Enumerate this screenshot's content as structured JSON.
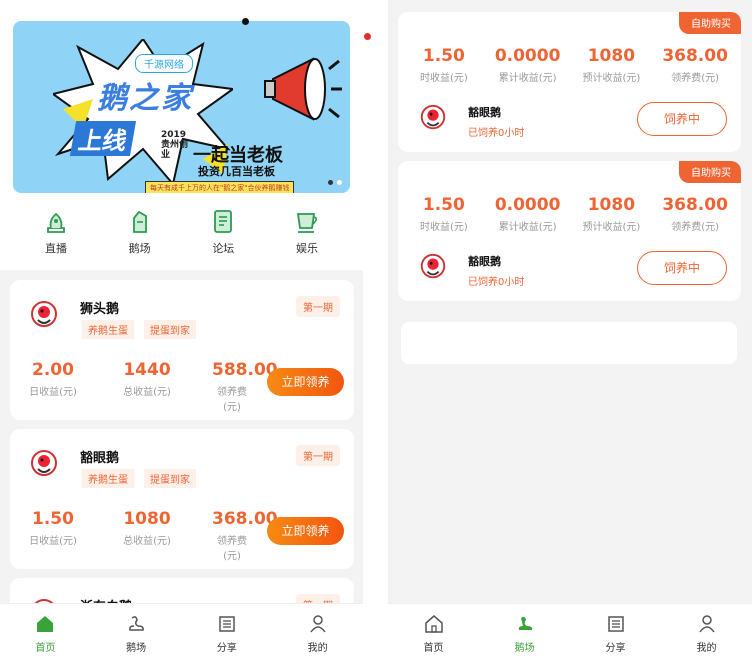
{
  "banner": {
    "tag": "千源网络",
    "brand": "鹅之家",
    "online": "上线",
    "year": "2019",
    "region": "贵州创业",
    "slogan": "一起当老板",
    "sub": "投资几百当老板",
    "strip": "每天有成千上万的人在\"鹅之家\"合伙养鹅赚钱"
  },
  "quick_nav": [
    {
      "label": "直播",
      "icon": "live-icon"
    },
    {
      "label": "鹅场",
      "icon": "farm-icon"
    },
    {
      "label": "论坛",
      "icon": "forum-icon"
    },
    {
      "label": "娱乐",
      "icon": "cup-icon"
    }
  ],
  "goose_cards": [
    {
      "name": "狮头鹅",
      "period": "第一期",
      "tags": [
        "养鹅生蛋",
        "提蛋到家"
      ],
      "stats": [
        {
          "value": "2.00",
          "label": "日收益(元)"
        },
        {
          "value": "1440",
          "label": "总收益(元)"
        },
        {
          "value": "588.00",
          "label": "领养费(元)"
        }
      ],
      "button": "立即领养"
    },
    {
      "name": "豁眼鹅",
      "period": "第一期",
      "tags": [
        "养鹅生蛋",
        "提蛋到家"
      ],
      "stats": [
        {
          "value": "1.50",
          "label": "日收益(元)"
        },
        {
          "value": "1080",
          "label": "总收益(元)"
        },
        {
          "value": "368.00",
          "label": "领养费(元)"
        }
      ],
      "button": "立即领养"
    },
    {
      "name": "浙东白鹅",
      "period": "第一期"
    }
  ],
  "tabbar_left": [
    {
      "label": "首页",
      "icon": "home-icon",
      "active": true
    },
    {
      "label": "鹅场",
      "icon": "goose-icon",
      "active": false
    },
    {
      "label": "分享",
      "icon": "share-icon",
      "active": false
    },
    {
      "label": "我的",
      "icon": "user-icon",
      "active": false
    }
  ],
  "my_geese": [
    {
      "badge": "自助购买",
      "stats": [
        {
          "value": "1.50",
          "label": "时收益(元)"
        },
        {
          "value": "0.0000",
          "label": "累计收益(元)"
        },
        {
          "value": "1080",
          "label": "预计收益(元)"
        },
        {
          "value": "368.00",
          "label": "领养费(元)"
        }
      ],
      "name": "豁眼鹅",
      "status": "已饲养0小时",
      "button": "饲养中"
    },
    {
      "badge": "自助购买",
      "stats": [
        {
          "value": "1.50",
          "label": "时收益(元)"
        },
        {
          "value": "0.0000",
          "label": "累计收益(元)"
        },
        {
          "value": "1080",
          "label": "预计收益(元)"
        },
        {
          "value": "368.00",
          "label": "领养费(元)"
        }
      ],
      "name": "豁眼鹅",
      "status": "已饲养0小时",
      "button": "饲养中"
    }
  ],
  "tabbar_right": [
    {
      "label": "首页",
      "icon": "home-icon",
      "active": false
    },
    {
      "label": "鹅场",
      "icon": "goose-icon",
      "active": true
    },
    {
      "label": "分享",
      "icon": "share-icon",
      "active": false
    },
    {
      "label": "我的",
      "icon": "user-icon",
      "active": false
    }
  ],
  "colors": {
    "accent": "#ef6433",
    "green": "#3aa23a",
    "banner": "#8fd4f6"
  }
}
